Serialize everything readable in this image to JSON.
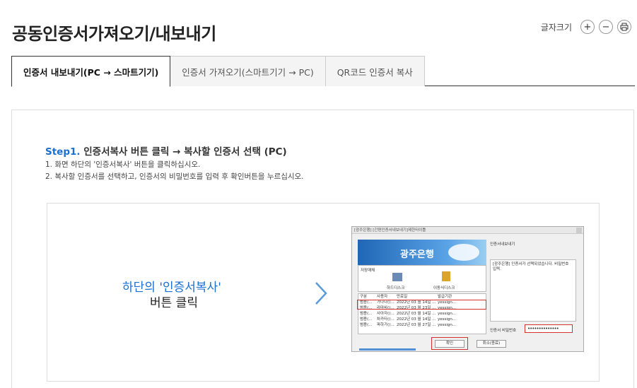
{
  "page": {
    "title": "공동인증서가져오기/내보내기"
  },
  "font_tools": {
    "label": "글자크기",
    "increase_icon": "+",
    "decrease_icon": "−",
    "print_icon": "print-icon"
  },
  "tabs": [
    {
      "label": "인증서 내보내기(PC → 스마트기기)",
      "active": true
    },
    {
      "label": "인증서 가져오기(스마트기기 → PC)",
      "active": false
    },
    {
      "label": "QR코드 인증서 복사",
      "active": false
    }
  ],
  "step": {
    "num": "Step1.",
    "title": " 인증서복사 버튼 클릭 → 복사할 인증서 선택 (PC)",
    "line1": "1. 화면 하단의 '인증서복사' 버튼을 클릭하십시오.",
    "line2": "2. 복사할 인증서를 선택하고, 인증서의 비밀번호를 입력 후 확인버튼을 누르십시오."
  },
  "hint": {
    "line1": "하단의 '인증서복사'",
    "line2": "버튼 클릭"
  },
  "dialog": {
    "title": "[광주은행] [간편인증서내보내기]제한타이틀",
    "bank_name": "광주은행",
    "storage_label": "저장매체",
    "storage_hdd": "하드디스크",
    "storage_usb": "이동식디스크",
    "columns": [
      "구분",
      "사용자",
      "만료일",
      "발급기관"
    ],
    "rows": [
      [
        "범용(...",
        "가나다()...",
        "2022년 03 월 14일 ...",
        "yessign..."
      ],
      [
        "범용(...",
        "라마바()...",
        "2022년 03 월 23일 ...",
        "yessign..."
      ],
      [
        "범용(...",
        "사아자()...",
        "2022년 03 월 14일 ...",
        "yessign..."
      ],
      [
        "범용(...",
        "차카타()...",
        "2022년 03 월 14일 ...",
        "yessign..."
      ],
      [
        "범용(...",
        "파하가()...",
        "2022년 03 월 27일 ...",
        "yessign..."
      ]
    ],
    "panel_title": "인증서내보내기",
    "panel_message": "[광주은행] 인증서가 선택되었습니다. 비밀번호 입력.",
    "password_label": "인증서 비밀번호",
    "password_value": "••••••••••••••",
    "ok_label": "확인",
    "cancel_label": "취소(종료)"
  },
  "colors": {
    "accent": "#1a6fd1",
    "highlight": "#d4332c"
  }
}
